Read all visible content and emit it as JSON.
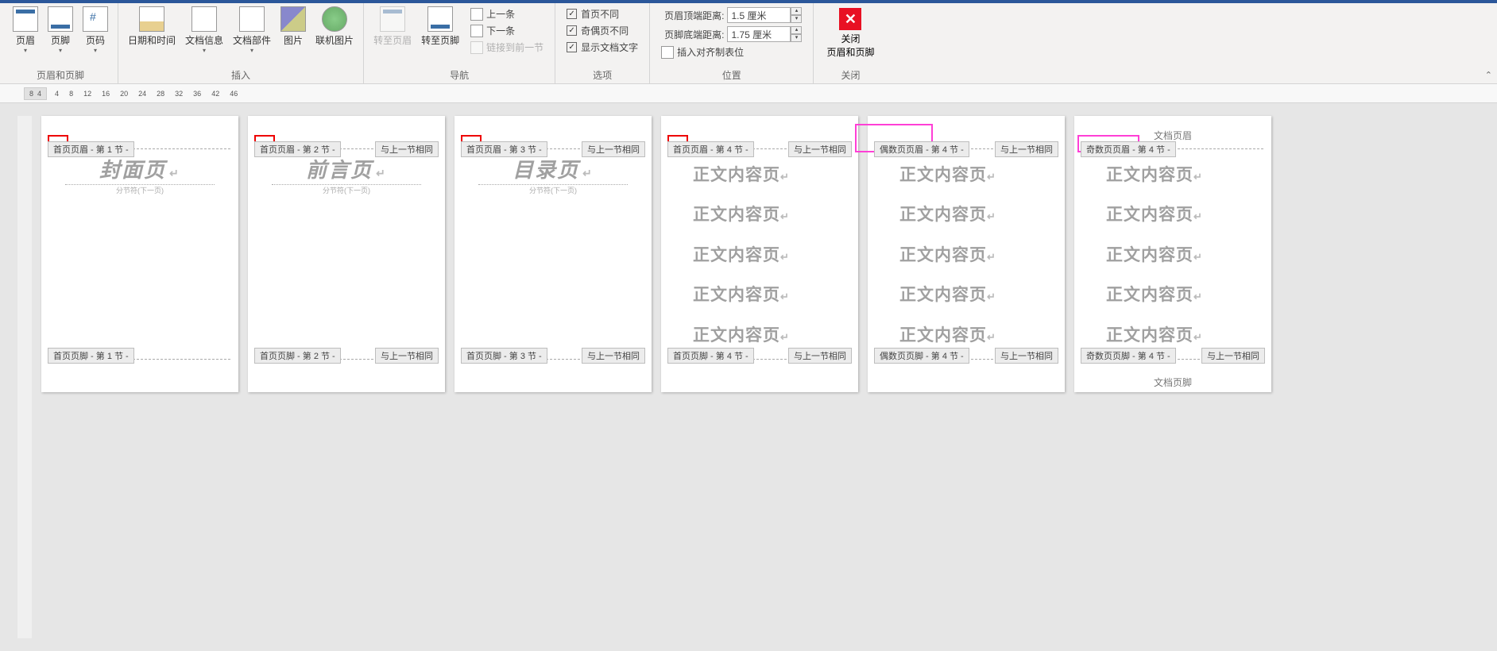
{
  "ribbon": {
    "groups": {
      "header_footer": {
        "label": "页眉和页脚",
        "header": "页眉",
        "footer": "页脚",
        "pagenum": "页码"
      },
      "insert": {
        "label": "插入",
        "datetime": "日期和时间",
        "docinfo": "文档信息",
        "docparts": "文档部件",
        "picture": "图片",
        "online_pic": "联机图片"
      },
      "nav": {
        "label": "导航",
        "goto_header": "转至页眉",
        "goto_footer": "转至页脚",
        "prev": "上一条",
        "next": "下一条",
        "link_prev": "链接到前一节"
      },
      "options": {
        "label": "选项",
        "first_diff": "首页不同",
        "odd_even_diff": "奇偶页不同",
        "show_doc_text": "显示文档文字"
      },
      "position": {
        "label": "位置",
        "header_top": "页眉顶端距离:",
        "header_top_val": "1.5 厘米",
        "footer_bottom": "页脚底端距离:",
        "footer_bottom_val": "1.75 厘米",
        "insert_tab": "插入对齐制表位"
      },
      "close": {
        "label": "关闭",
        "close_btn_l1": "关闭",
        "close_btn_l2": "页眉和页脚"
      }
    }
  },
  "ruler_top_boxed": [
    "8",
    "4"
  ],
  "ruler_top": [
    "4",
    "8",
    "12",
    "16",
    "20",
    "24",
    "28",
    "32",
    "36",
    "42",
    "46"
  ],
  "pages": [
    {
      "title": "封面页",
      "hdr_tag": "首页页眉 - 第 1 节 -",
      "ftr_tag": "首页页脚 - 第 1 节 -",
      "hdr_tag_right": "",
      "ftr_tag_right": "",
      "break_text": "分节符(下一页)",
      "red_box": true
    },
    {
      "title": "前言页",
      "hdr_tag": "首页页眉 - 第 2 节 -",
      "hdr_tag_right": "与上一节相同",
      "ftr_tag": "首页页脚 - 第 2 节 -",
      "ftr_tag_right": "与上一节相同",
      "break_text": "分节符(下一页)",
      "red_box": true
    },
    {
      "title": "目录页",
      "hdr_tag": "首页页眉 - 第 3 节 -",
      "hdr_tag_right": "与上一节相同",
      "ftr_tag": "首页页脚 - 第 3 节 -",
      "ftr_tag_right": "与上一节相同",
      "break_text": "分节符(下一页)",
      "red_box": true
    },
    {
      "body_repeat": "正文内容页",
      "hdr_tag": "首页页眉 - 第 4 节 -",
      "hdr_tag_right": "与上一节相同",
      "ftr_tag": "首页页脚 - 第 4 节 -",
      "ftr_tag_right": "与上一节相同",
      "red_box": true
    },
    {
      "body_repeat": "正文内容页",
      "hdr_tag": "偶数页页眉",
      "hdr_tag_sec": "- 第 4 节 -",
      "hdr_tag_right": "与上一节相同",
      "ftr_tag": "偶数页页脚 - 第 4 节 -",
      "ftr_tag_right": "与上一节相同",
      "pink_box": true
    },
    {
      "body_repeat": "正文内容页",
      "hdr_text": "文档页眉",
      "ftr_text": "文档页脚",
      "hdr_tag": "奇数页页眉",
      "hdr_tag_sec": "- 第 4 节 -",
      "ftr_tag": "奇数页页脚 - 第 4 节 -",
      "ftr_tag_right": "与上一节相同",
      "pink_box": true
    }
  ]
}
